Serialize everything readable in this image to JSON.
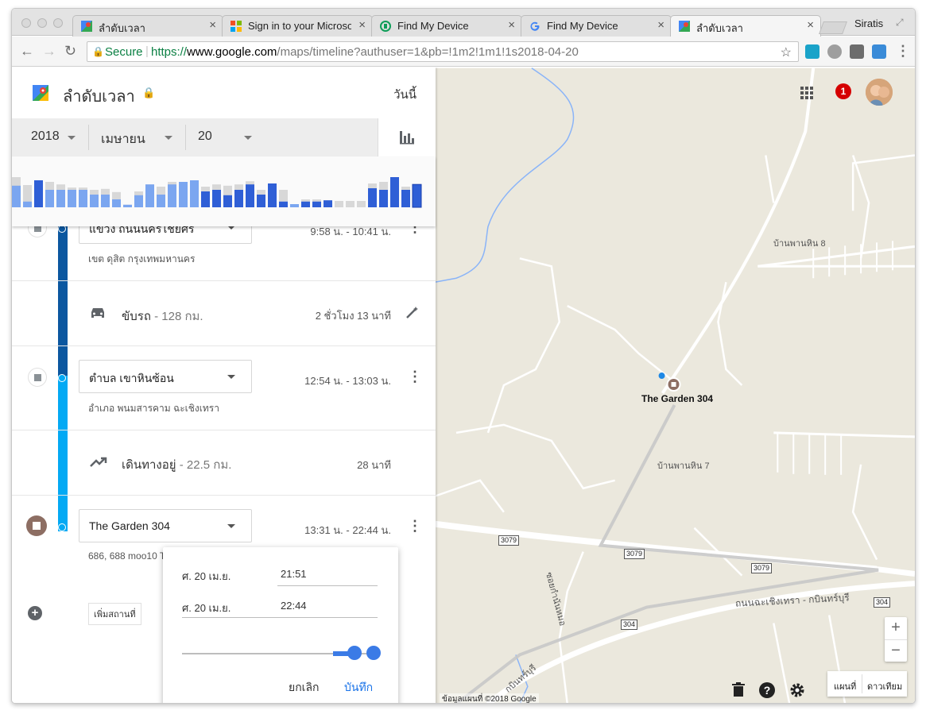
{
  "browser": {
    "tabs": [
      {
        "label": "ลำดับเวลา",
        "icon": "google-maps-icon",
        "active": false
      },
      {
        "label": "Sign in to your Microsoft",
        "icon": "microsoft-icon",
        "active": false
      },
      {
        "label": "Find My Device",
        "icon": "find-my-device-icon",
        "active": false
      },
      {
        "label": "Find My Device",
        "icon": "google-icon",
        "active": false
      },
      {
        "label": "ลำดับเวลา",
        "icon": "google-maps-icon",
        "active": true
      }
    ],
    "profile_name": "Siratis",
    "omnibox": {
      "secure_label": "Secure",
      "url_scheme": "https://",
      "url_host": "www.google.com",
      "url_path": "/maps/timeline?authuser=1&pb=!1m2!1m1!1s2018-04-20"
    }
  },
  "panel": {
    "title": "ลำดับเวลา",
    "today_label": "วันนี้",
    "date": {
      "year": "2018",
      "month": "เมษายน",
      "day": "20"
    },
    "histogram": {
      "max": 100,
      "bars": [
        {
          "total": 95,
          "filled": 68,
          "dark": false
        },
        {
          "total": 70,
          "filled": 18,
          "dark": false
        },
        {
          "total": 85,
          "filled": 85,
          "dark": true
        },
        {
          "total": 80,
          "filled": 55,
          "dark": false
        },
        {
          "total": 72,
          "filled": 55,
          "dark": false
        },
        {
          "total": 62,
          "filled": 55,
          "dark": false
        },
        {
          "total": 62,
          "filled": 55,
          "dark": false
        },
        {
          "total": 55,
          "filled": 40,
          "dark": false
        },
        {
          "total": 58,
          "filled": 40,
          "dark": false
        },
        {
          "total": 48,
          "filled": 25,
          "dark": false
        },
        {
          "total": 8,
          "filled": 8,
          "dark": false
        },
        {
          "total": 50,
          "filled": 38,
          "dark": false
        },
        {
          "total": 72,
          "filled": 72,
          "dark": false
        },
        {
          "total": 65,
          "filled": 40,
          "dark": false
        },
        {
          "total": 80,
          "filled": 72,
          "dark": false
        },
        {
          "total": 80,
          "filled": 80,
          "dark": false
        },
        {
          "total": 85,
          "filled": 85,
          "dark": false
        },
        {
          "total": 65,
          "filled": 50,
          "dark": true
        },
        {
          "total": 72,
          "filled": 55,
          "dark": true
        },
        {
          "total": 68,
          "filled": 38,
          "dark": true
        },
        {
          "total": 72,
          "filled": 55,
          "dark": true
        },
        {
          "total": 82,
          "filled": 72,
          "dark": true
        },
        {
          "total": 55,
          "filled": 40,
          "dark": true
        },
        {
          "total": 75,
          "filled": 75,
          "dark": true
        },
        {
          "total": 55,
          "filled": 18,
          "dark": true
        },
        {
          "total": 10,
          "filled": 10,
          "dark": false
        },
        {
          "total": 25,
          "filled": 18,
          "dark": true
        },
        {
          "total": 25,
          "filled": 18,
          "dark": true
        },
        {
          "total": 22,
          "filled": 22,
          "dark": true
        },
        {
          "total": 20,
          "filled": 0,
          "dark": false
        },
        {
          "total": 20,
          "filled": 0,
          "dark": false
        },
        {
          "total": 20,
          "filled": 0,
          "dark": false
        },
        {
          "total": 75,
          "filled": 60,
          "dark": true
        },
        {
          "total": 80,
          "filled": 55,
          "dark": true
        },
        {
          "total": 95,
          "filled": 95,
          "dark": true
        },
        {
          "total": 65,
          "filled": 55,
          "dark": true
        },
        {
          "total": 72,
          "filled": 72,
          "dark": true
        }
      ]
    },
    "segments": {
      "place1": {
        "name": "แขวง ถนนนครไชยศรี",
        "time": "9:58 น. - 10:41 น.",
        "address": "เขต ดุสิต กรุงเทพมหานคร"
      },
      "drive": {
        "mode": "ขับรถ",
        "distance": "- 128 กม.",
        "duration": "2 ชั่วโมง 13 นาที"
      },
      "place2": {
        "name": "ตำบล เขาหินซ้อน",
        "time": "12:54 น. - 13:03 น.",
        "address": "อำเภอ พนมสารคาม ฉะเชิงเทรา"
      },
      "walk": {
        "mode": "เดินทางอยู่",
        "distance": "- 22.5 กม.",
        "duration": "28 นาที"
      },
      "place3": {
        "name": "The Garden 304",
        "time": "13:31 น. - 22:44 น.",
        "address": "686, 688 moo10 T"
      }
    },
    "add_place_label": "เพิ่มสถานที่"
  },
  "popup": {
    "start_date": "ศ. 20 เม.ย.",
    "start_time": "21:51",
    "end_date": "ศ. 20 เม.ย.",
    "end_time": "22:44",
    "cancel_label": "ยกเลิก",
    "save_label": "บันทึก"
  },
  "map": {
    "notification_count": "1",
    "place_label": "The Garden 304",
    "labels": {
      "village8": "บ้านพานหิน 8",
      "village7": "บ้านพานหิน 7",
      "road_main": "ถนนฉะเชิงเทรา - กบินทร์บุรี",
      "road_side": "ซอยกำนันหมอ",
      "road_lower": "กบินทร์บุรี"
    },
    "shields": {
      "r3079a": "3079",
      "r3079b": "3079",
      "r3079c": "3079",
      "r304a": "304",
      "r304b": "304"
    },
    "zoom_in": "+",
    "zoom_out": "−",
    "map_type_map": "แผนที่",
    "map_type_satellite": "ดาวเทียม",
    "copyright": "ข้อมูลแผนที่ ©2018 Google"
  },
  "colors": {
    "map_bg": "#ebe8dd",
    "road": "#ffffff",
    "water": "#8ab4f8",
    "drive_line": "#0b57a0",
    "walk_line": "#03a9f4",
    "bar_light": "#7ba6f0",
    "bar_dark": "#2f5fd6",
    "bar_bg": "#d8d8d8"
  }
}
